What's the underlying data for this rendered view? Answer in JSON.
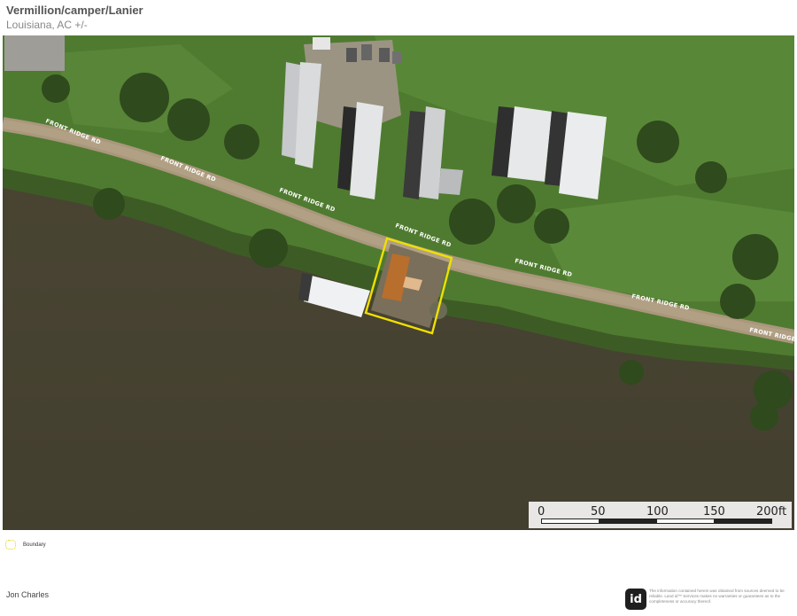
{
  "header": {
    "title": "Vermillion/camper/Lanier",
    "subtitle": "Louisiana,  AC +/-"
  },
  "map": {
    "road_name": "FRONT RIDGE RD",
    "boundary_color": "#f0e000",
    "water_color": "#4b4634",
    "land_color": "#4e7a2e"
  },
  "scale": {
    "labels": [
      "0",
      "50",
      "100",
      "150",
      "200ft"
    ]
  },
  "legend": {
    "items": [
      {
        "label": "Boundary",
        "icon": "boundary-swatch"
      }
    ]
  },
  "footer": {
    "agent": "Jon Charles",
    "logo_text": "id",
    "disclaimer": "The information contained herein was obtained from sources deemed to be reliable. Land id™ Services makes no warranties or guarantees as to the completeness or accuracy thereof."
  }
}
